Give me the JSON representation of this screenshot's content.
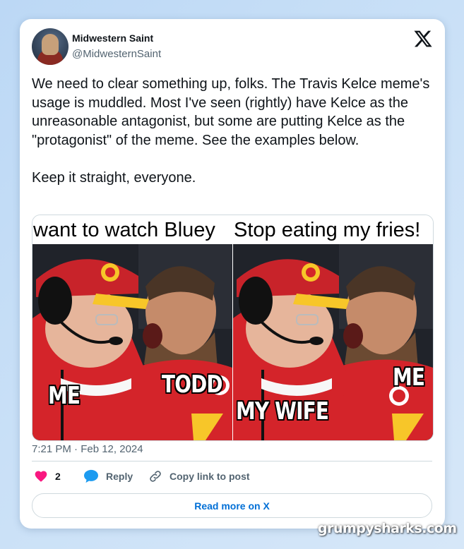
{
  "author": {
    "display_name": "Midwestern Saint",
    "handle": "@MidwesternSaint"
  },
  "brand": {
    "logo": "x-logo-icon"
  },
  "tweet": {
    "paragraphs": [
      "We need to clear something up, folks. The Travis Kelce meme's usage is muddled. Most I've seen (rightly) have Kelce as the unreasonable antagonist, but some are putting Kelce as the \"protagonist\" of the meme. See the examples below.",
      "Keep it straight, everyone."
    ],
    "timestamp": "7:21 PM · Feb 12, 2024"
  },
  "media": {
    "panels": [
      {
        "caption": "want to watch Bluey",
        "labels": [
          "ME",
          "TODD"
        ]
      },
      {
        "caption": "Stop eating my fries!",
        "labels": [
          "MY WIFE",
          "ME"
        ]
      }
    ]
  },
  "actions": {
    "like_count": "2",
    "reply_label": "Reply",
    "copy_label": "Copy link to post"
  },
  "read_more_label": "Read more on X",
  "watermark": "grumpysharks.com",
  "colors": {
    "like": "#f91880",
    "reply": "#1d9bf0",
    "link": "#006fd6",
    "jersey_red": "#d4242a",
    "cap_yellow": "#f7c629"
  }
}
